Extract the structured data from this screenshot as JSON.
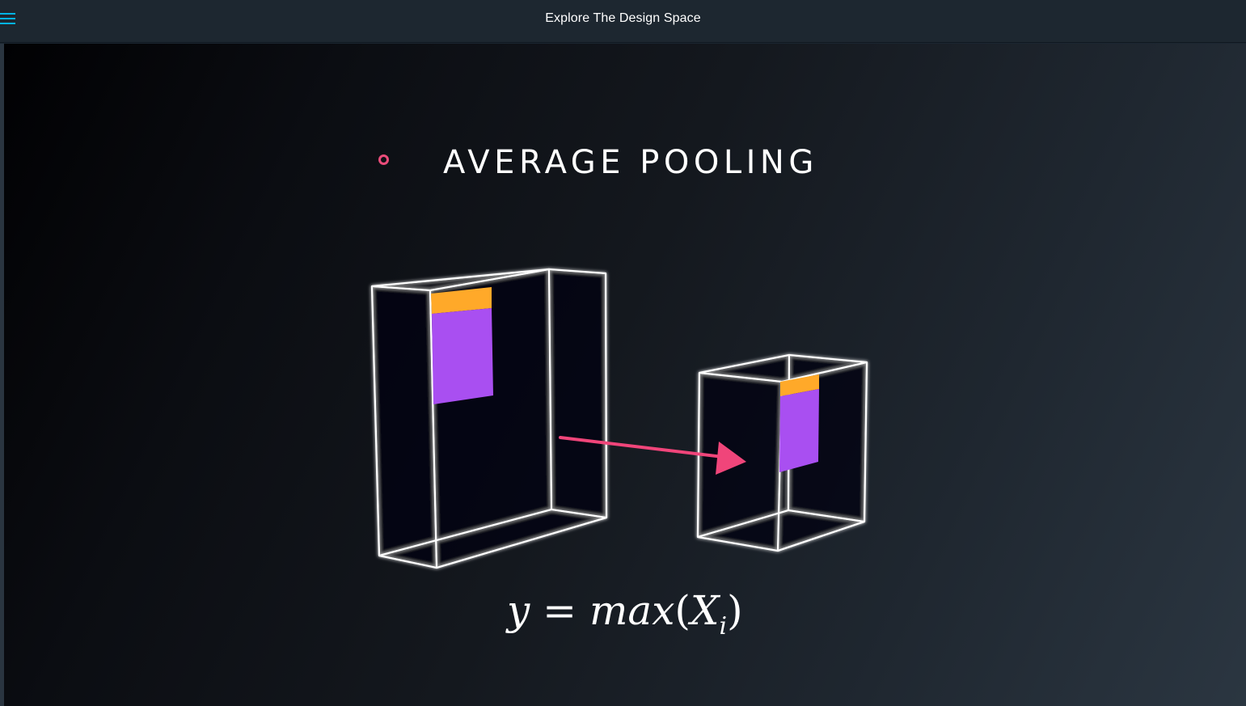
{
  "header": {
    "title": "Explore The Design Space",
    "menu_icon": "hamburger-menu-icon"
  },
  "slide": {
    "title": "AVERAGE POOLING",
    "bullet_color": "#ea4c7a",
    "formula": {
      "y": "y",
      "equals": "=",
      "func": "max",
      "open_paren": "(",
      "var": "X",
      "subscript": "i",
      "close_paren": ")"
    },
    "colors": {
      "highlight_top": "#ffa929",
      "highlight_body": "#a94ff1",
      "arrow": "#f0457a",
      "wireframe": "#ffffff"
    }
  }
}
